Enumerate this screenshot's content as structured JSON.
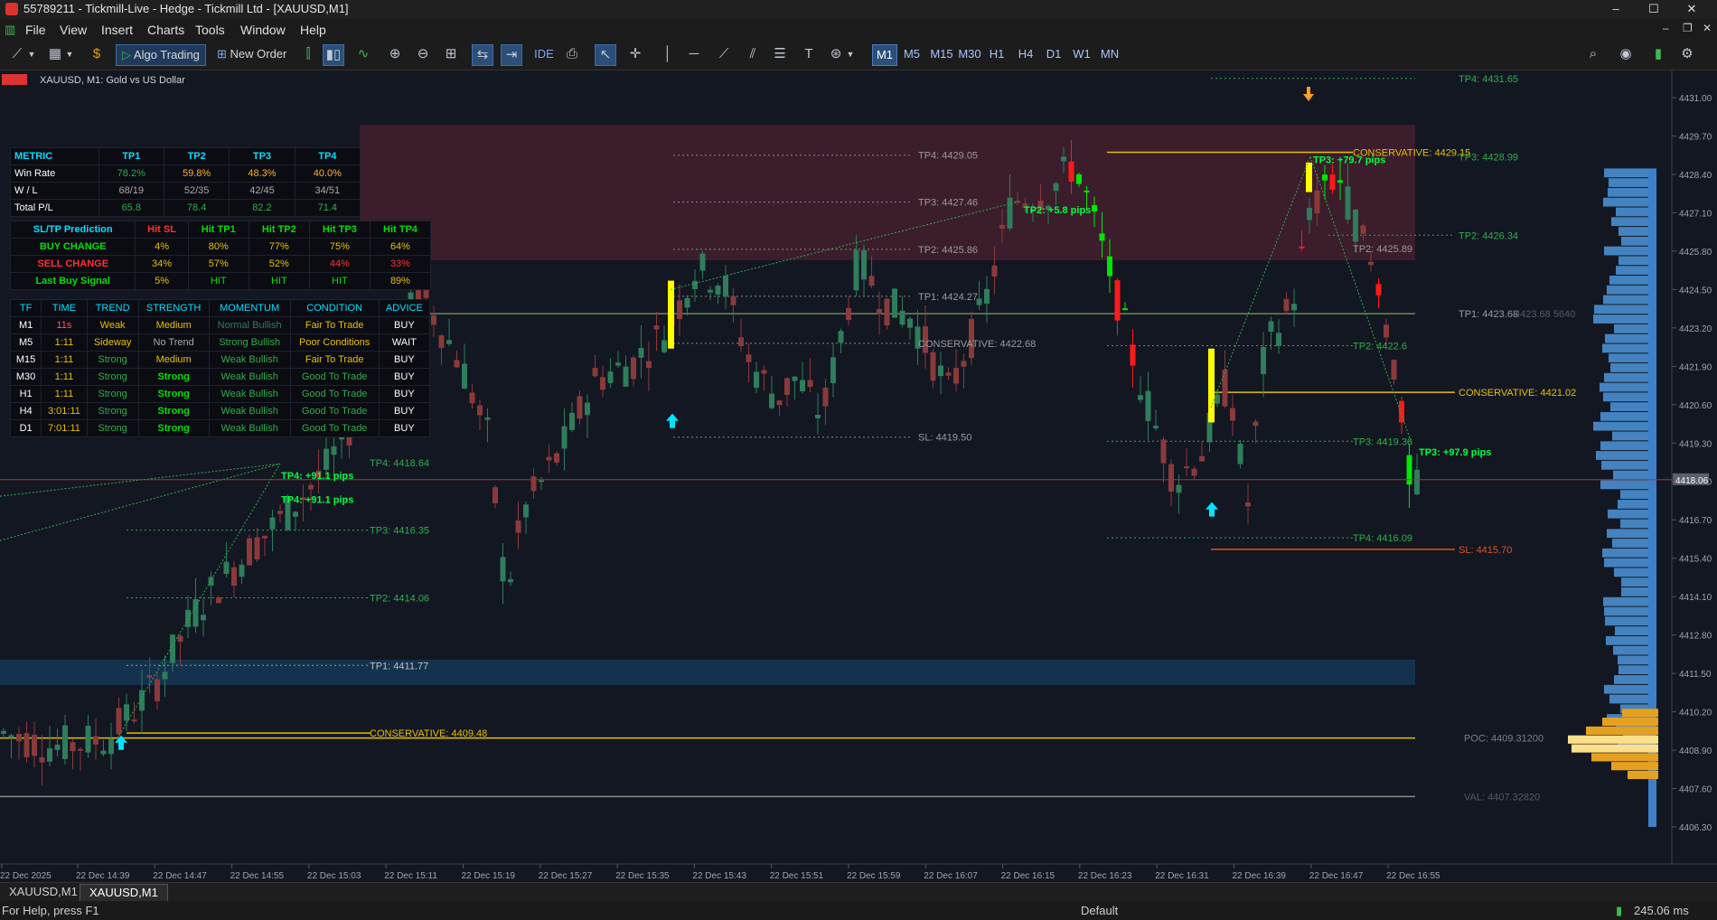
{
  "window": {
    "title": "55789211 - Tickmill-Live - Hedge - Tickmill Ltd - [XAUUSD,M1]",
    "controls": [
      "–",
      "☐",
      "✕"
    ]
  },
  "menu": {
    "items": [
      "File",
      "View",
      "Insert",
      "Charts",
      "Tools",
      "Window",
      "Help"
    ],
    "right_controls": [
      "–",
      "❐",
      "✕"
    ]
  },
  "toolbar": {
    "algo_label": "Algo Trading",
    "order_label": "New Order",
    "ide_label": "IDE",
    "timeframes": [
      "M1",
      "M5",
      "M15",
      "M30",
      "H1",
      "H4",
      "D1",
      "W1",
      "MN"
    ],
    "active_timeframe": "M1"
  },
  "chart": {
    "symbol_label": "XAUUSD, M1:  Gold vs US Dollar",
    "price_axis": [
      "4431.00",
      "4429.70",
      "4428.40",
      "4427.10",
      "4425.80",
      "4424.50",
      "4423.20",
      "4421.90",
      "4420.60",
      "4419.30",
      "4418.00",
      "4416.70",
      "4415.40",
      "4414.10",
      "4412.80",
      "4411.50",
      "4410.20",
      "4408.90",
      "4407.60",
      "4406.30"
    ],
    "current_price": "4418.06",
    "time_axis": [
      "22 Dec 2025",
      "22 Dec 14:39",
      "22 Dec 14:47",
      "22 Dec 14:55",
      "22 Dec 15:03",
      "22 Dec 15:11",
      "22 Dec 15:19",
      "22 Dec 15:27",
      "22 Dec 15:35",
      "22 Dec 15:43",
      "22 Dec 15:51",
      "22 Dec 15:59",
      "22 Dec 16:07",
      "22 Dec 16:15",
      "22 Dec 16:23",
      "22 Dec 16:31",
      "22 Dec 16:39",
      "22 Dec 16:47",
      "22 Dec 16:55"
    ],
    "level_labels": {
      "tp4_top": "TP4: 4431.65",
      "tp4_mid": "TP4: 4429.05",
      "tp3_mid": "TP3: 4427.46",
      "tp2_mid": "TP2: 4425.86",
      "tp1_mid": "TP1: 4424.27",
      "cons_mid": "CONSERVATIVE: 4422.68",
      "sl_mid": "SL: 4419.50",
      "cons_right_top": "CONSERVATIVE: 4429.15",
      "tp3_right": "TP3: 4428.99",
      "tp2_right": "TP2: 4426.34",
      "tp2_right_mid": "TP2: 4425.89",
      "tp1_right": "TP1: 4423.68",
      "vah": "4423.68 5640",
      "tp2_right_low": "TP2: 4422.6",
      "cons_right_low": "CONSERVATIVE: 4421.02",
      "tp3_right_low": "TP3: 4419.36",
      "tp4_left": "TP4: 4418.64",
      "tp3_left": "TP3: 4416.35",
      "tp4_right_low": "TP4: 4416.09",
      "sl_right": "SL: 4415.70",
      "tp2_left": "TP2: 4414.06",
      "tp1_left": "TP1: 4411.77",
      "cons_left": "CONSERVATIVE: 4409.48",
      "poc": "POC: 4409.31200",
      "val": "VAL: 4407.32820"
    },
    "pip_labels": {
      "a": "TP3: +79.7 pips",
      "b": "TP3: +97.9 pips",
      "c": "TP2: +5.8 pips",
      "d": "TP4: +91.1 pips",
      "e": "TP4: +91.1 pips"
    }
  },
  "metric_table": {
    "headers": [
      "METRIC",
      "TP1",
      "TP2",
      "TP3",
      "TP4"
    ],
    "rows": [
      [
        "Win Rate",
        "78.2%",
        "59.8%",
        "48.3%",
        "40.0%"
      ],
      [
        "W / L",
        "68/19",
        "52/35",
        "42/45",
        "34/51"
      ],
      [
        "Total P/L",
        "65.8",
        "78.4",
        "82.2",
        "71.4"
      ]
    ]
  },
  "prediction_table": {
    "headers": [
      "SL/TP Prediction",
      "Hit SL",
      "Hit TP1",
      "Hit TP2",
      "Hit TP3",
      "Hit TP4"
    ],
    "rows": [
      [
        "BUY CHANGE",
        "4%",
        "80%",
        "77%",
        "75%",
        "64%"
      ],
      [
        "SELL CHANGE",
        "34%",
        "57%",
        "52%",
        "44%",
        "33%"
      ],
      [
        "Last Buy Signal",
        "5%",
        "HIT",
        "HIT",
        "HIT",
        "89%"
      ]
    ]
  },
  "trend_table": {
    "headers": [
      "TF",
      "TIME",
      "TREND",
      "STRENGTH",
      "MOMENTUM",
      "CONDITION",
      "ADVICE"
    ],
    "rows": [
      [
        "M1",
        "11s",
        "Weak",
        "Medium",
        "Normal Bullish",
        "Fair To Trade",
        "BUY"
      ],
      [
        "M5",
        "1:11",
        "Sideway",
        "No Trend",
        "Strong Bullish",
        "Poor Conditions",
        "WAIT"
      ],
      [
        "M15",
        "1:11",
        "Strong",
        "Medium",
        "Weak Bullish",
        "Fair To Trade",
        "BUY"
      ],
      [
        "M30",
        "1:11",
        "Strong",
        "Strong",
        "Weak Bullish",
        "Good To Trade",
        "BUY"
      ],
      [
        "H1",
        "1:11",
        "Strong",
        "Strong",
        "Weak Bullish",
        "Good To Trade",
        "BUY"
      ],
      [
        "H4",
        "3:01:11",
        "Strong",
        "Strong",
        "Weak Bullish",
        "Good To Trade",
        "BUY"
      ],
      [
        "D1",
        "7:01:11",
        "Strong",
        "Strong",
        "Weak Bullish",
        "Good To Trade",
        "BUY"
      ]
    ]
  },
  "tabs": [
    "XAUUSD,M1",
    "XAUUSD,M1"
  ],
  "status": {
    "help": "For Help, press F1",
    "profile": "Default",
    "ping": "245.06 ms"
  },
  "colors": {
    "bull": "#2e7d5b",
    "bear": "#8b3a3a",
    "bull_bright": "#00e600",
    "bear_bright": "#ff1a1a",
    "gold": "#e6c000",
    "green_level": "#2eae4a",
    "zone": "#4a2030"
  }
}
